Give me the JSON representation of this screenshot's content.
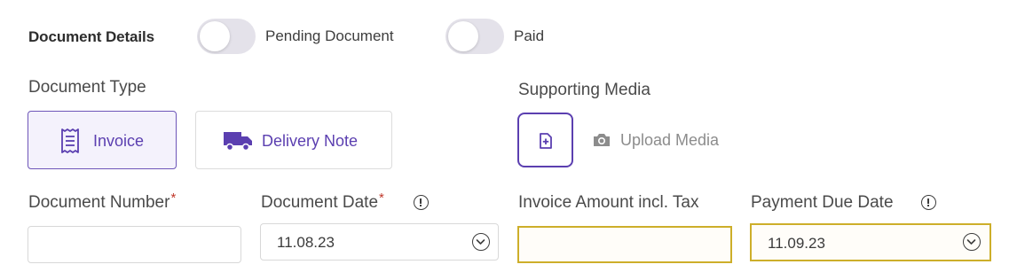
{
  "header": {
    "title": "Document Details",
    "toggles": [
      {
        "label": "Pending Document",
        "on": false
      },
      {
        "label": "Paid",
        "on": false
      }
    ]
  },
  "document_type": {
    "label": "Document Type",
    "options": [
      {
        "label": "Invoice",
        "icon": "receipt-icon",
        "selected": true
      },
      {
        "label": "Delivery Note",
        "icon": "truck-icon",
        "selected": false
      }
    ]
  },
  "supporting_media": {
    "label": "Supporting Media",
    "add_icon": "add-file-icon",
    "upload_label": "Upload Media",
    "upload_icon": "camera-icon"
  },
  "fields": {
    "document_number": {
      "label": "Document Number",
      "required": true,
      "value": ""
    },
    "document_date": {
      "label": "Document Date",
      "required": true,
      "value": "11.08.23",
      "info": true
    },
    "invoice_amount": {
      "label": "Invoice Amount incl. Tax",
      "value": "",
      "highlighted": true
    },
    "payment_due_date": {
      "label": "Payment Due Date",
      "value": "11.09.23",
      "info": true,
      "highlighted": true
    }
  },
  "colors": {
    "accent": "#5b3fb0",
    "selected_bg": "#f4f2fc",
    "highlight_border": "#cdae2a",
    "required": "#c0392b",
    "toggle_off": "#e4e2ea"
  }
}
